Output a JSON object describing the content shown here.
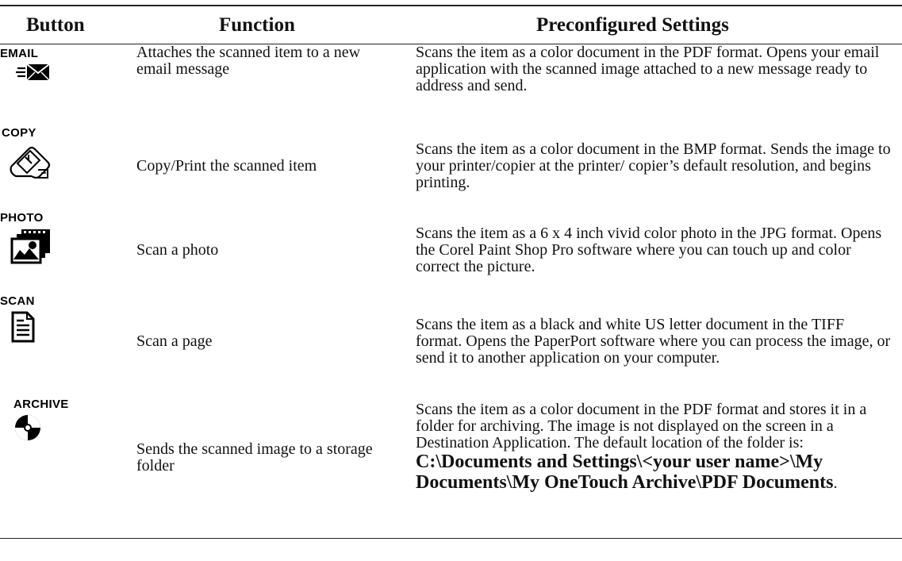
{
  "headers": {
    "button": "Button",
    "function": "Function",
    "settings": "Preconfigured Settings"
  },
  "rows": [
    {
      "button_label": "EMAIL",
      "icon": "email-icon",
      "function": "Attaches the scanned item to a new email message",
      "settings": "Scans the item as a color document in the PDF format. Opens your email application with the scanned image attached to a new message ready to address and send."
    },
    {
      "button_label": "COPY",
      "icon": "copy-icon",
      "function": "Copy/Print the scanned item",
      "settings": "Scans the item as a color document in the BMP format. Sends the image to your printer/copier at the printer/ copier’s default resolution, and begins printing."
    },
    {
      "button_label": "PHOTO",
      "icon": "photo-icon",
      "function": "Scan a photo",
      "settings": "Scans the item as a 6 x 4 inch vivid color photo in the JPG format. Opens the Corel Paint Shop Pro software where you can touch up and color correct the picture."
    },
    {
      "button_label": "SCAN",
      "icon": "scan-document-icon",
      "function": "Scan a page",
      "settings": "Scans the item as a black and white US letter document in the TIFF format. Opens the PaperPort software where you can process the image, or send it to another application on your computer."
    },
    {
      "button_label": "ARCHIVE",
      "icon": "archive-disc-icon",
      "function": "Sends the scanned image to a storage folder",
      "settings": "Scans the item as a color document in the PDF format and stores it in a folder for archiving. The image is not displayed on the screen in a Destination Application. The default location of the folder is: ",
      "settings_path": "C:\\Documents and Settings\\<your user name>\\My Documents\\My OneTouch Archive\\PDF Documents",
      "settings_end": "."
    }
  ]
}
